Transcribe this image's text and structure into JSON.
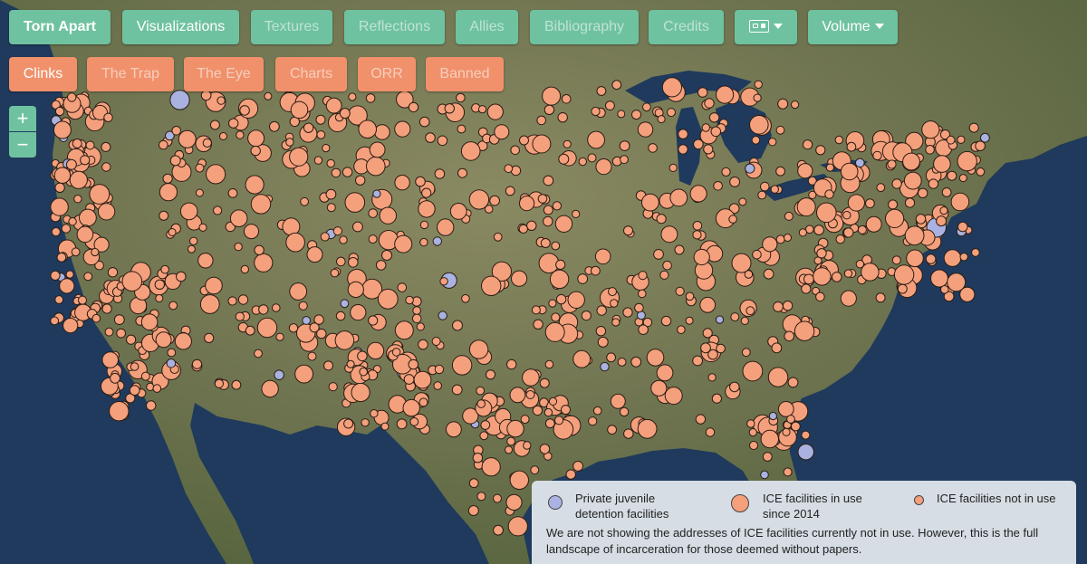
{
  "nav_top": [
    {
      "label": "Torn Apart",
      "style": "bold"
    },
    {
      "label": "Visualizations",
      "style": "active"
    },
    {
      "label": "Textures",
      "style": "dim"
    },
    {
      "label": "Reflections",
      "style": "dim"
    },
    {
      "label": "Allies",
      "style": "dim"
    },
    {
      "label": "Bibliography",
      "style": "dim"
    },
    {
      "label": "Credits",
      "style": "dim"
    },
    {
      "label": "",
      "style": "lang"
    },
    {
      "label": "Volume",
      "style": "dropdown"
    }
  ],
  "nav_bottom": [
    {
      "label": "Clinks",
      "style": "active"
    },
    {
      "label": "The Trap",
      "style": "dim"
    },
    {
      "label": "The Eye",
      "style": "dim"
    },
    {
      "label": "Charts",
      "style": "dim"
    },
    {
      "label": "ORR",
      "style": "dim"
    },
    {
      "label": "Banned",
      "style": "dim"
    }
  ],
  "zoom": {
    "in": "+",
    "out": "−"
  },
  "colors": {
    "teal": "#6fc2a0",
    "salmon": "#f0916b",
    "ice": "#f4a07c",
    "private": "#a9b2e0",
    "land": "#5d6b45",
    "water": "#1f3a5c"
  },
  "legend": {
    "private_label": "Private juvenile detention facilities",
    "ice_in_use_label": "ICE facilities in use since 2014",
    "ice_not_in_use_label": "ICE facilities not in use",
    "note": "We are not showing the addresses of ICE facilities currently not in use. However, this is the full landscape of incarceration for those deemed without papers."
  }
}
